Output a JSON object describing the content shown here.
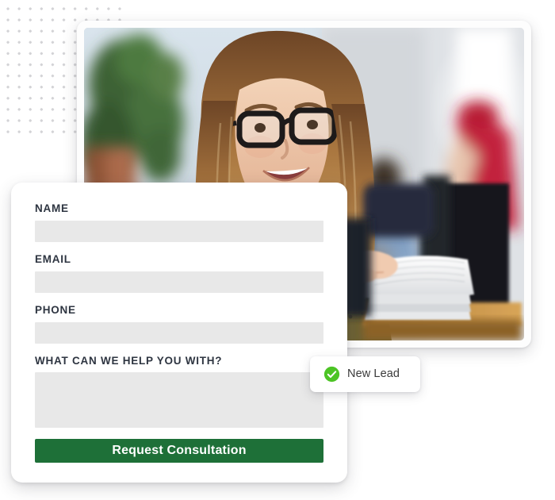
{
  "decor": {
    "dot_grid_name": "dot-grid-pattern",
    "dot_color": "#d3d3d6"
  },
  "photo_card": {
    "name": "office-consultation-photo",
    "alt": "Smiling woman with glasses in an office, colleagues working in the background, hand flipping through a stack of papers",
    "palette": {
      "wall": "#cfd9e2",
      "hair": "#b98a58",
      "skin": "#e8bfa2",
      "glasses": "#201c1c",
      "sweater": "#6d6234",
      "plant": "#3d6336",
      "pot": "#a9674a",
      "plaid_shirt": "#7d9ec4",
      "red_top": "#c2213c",
      "monitor": "#1b1b20",
      "desk": "#c08a42",
      "papers": "#f2f2f0"
    }
  },
  "form": {
    "name_label": "NAME",
    "name_value": "",
    "name_placeholder": "",
    "email_label": "EMAIL",
    "email_value": "",
    "email_placeholder": "",
    "phone_label": "PHONE",
    "phone_value": "",
    "phone_placeholder": "",
    "message_label": "WHAT CAN WE HELP YOU WITH?",
    "message_value": "",
    "message_placeholder": "",
    "submit_label": "Request Consultation",
    "submit_color": "#1e7038",
    "input_background": "#e8e8e8",
    "label_color": "#2e3541"
  },
  "toast": {
    "label": "New Lead",
    "icon": "check-circle-icon",
    "icon_color": "#4cc425"
  }
}
